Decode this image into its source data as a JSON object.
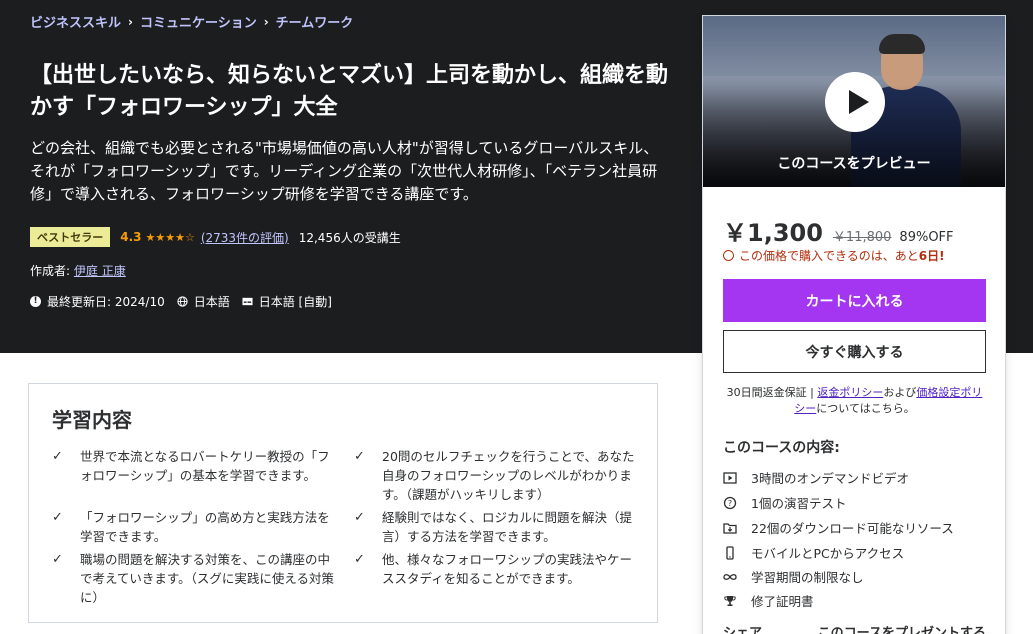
{
  "breadcrumb": {
    "items": [
      "ビジネススキル",
      "コミュニケーション",
      "チームワーク"
    ],
    "separator": "›"
  },
  "course": {
    "title": "【出世したいなら、知らないとマズい】上司を動かし、組織を動かす「フォロワーシップ」大全",
    "subtitle": "どの会社、組織でも必要とされる\"市場場価値の高い人材\"が習得しているグローバルスキル、それが「フォロワーシップ」です。リーディング企業の「次世代人材研修」、「ベテラン社員研修」で導入される、フォロワーシップ研修を学習できる講座です。",
    "badge": "ベストセラー",
    "rating": "4.3",
    "rating_stars": 4.3,
    "rating_count": "(2733件の評価)",
    "students": "12,456人の受講生",
    "author_label": "作成者:",
    "author_name": "伊庭 正康",
    "last_updated": "最終更新日: 2024/10",
    "language": "日本語",
    "captions": "日本語 [自動]"
  },
  "learn": {
    "title": "学習内容",
    "items": [
      "世界で本流となるロバートケリー教授の「フォロワーシップ」の基本を学習できます。",
      "20問のセルフチェックを行うことで、あなた自身のフォロワーシップのレベルがわかります。（課題がハッキリします）",
      "「フォロワーシップ」の高め方と実践方法を学習できます。",
      "経験則ではなく、ロジカルに問題を解決（提言）する方法を学習できます。",
      "職場の問題を解決する対策を、この講座の中で考えていきます。（スグに実践に使える対策に）",
      "他、様々なフォローワシップの実践法やケーススタディを知ることができます。"
    ]
  },
  "sidebar": {
    "preview_label": "このコースをプレビュー",
    "price": "￥1,300",
    "original_price": "￥11,800",
    "discount": "89%OFF",
    "deadline_prefix": "この価格で購入できるのは、あと",
    "deadline_days": "6日!",
    "cart_button": "カートに入れる",
    "buy_button": "今すぐ購入する",
    "guarantee_text": "30日間返金保証 | ",
    "refund_policy": "返金ポリシー",
    "and": "および",
    "pricing_policy": "価格設定ポリシー",
    "guarantee_tail": "についてはこちら。",
    "includes_title": "このコースの内容:",
    "includes": [
      {
        "icon": "video-icon",
        "label": "3時間のオンデマンドビデオ"
      },
      {
        "icon": "quiz-icon",
        "label": "1個の演習テスト"
      },
      {
        "icon": "download-icon",
        "label": "22個のダウンロード可能なリソース"
      },
      {
        "icon": "mobile-icon",
        "label": "モバイルとPCからアクセス"
      },
      {
        "icon": "infinity-icon",
        "label": "学習期間の制限なし"
      },
      {
        "icon": "trophy-icon",
        "label": "修了証明書"
      }
    ],
    "share": "シェア",
    "gift": "このコースをプレゼントする"
  },
  "colors": {
    "header_bg": "#1c1d1f",
    "accent_purple": "#a435f0",
    "rating_orange": "#f69c08",
    "badge_yellow": "#eceb98",
    "link_lavender": "#c0c4fc",
    "deadline_red": "#b32d0f"
  }
}
